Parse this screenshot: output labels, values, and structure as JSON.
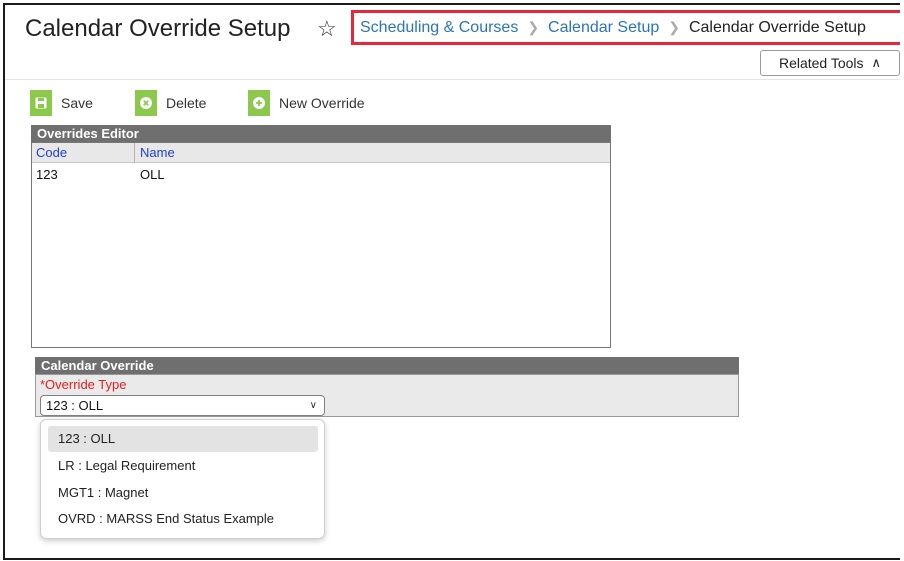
{
  "header": {
    "title": "Calendar Override Setup",
    "breadcrumb": [
      "Scheduling & Courses",
      "Calendar Setup",
      "Calendar Override Setup"
    ],
    "related_tools_label": "Related Tools"
  },
  "toolbar": {
    "save_label": "Save",
    "delete_label": "Delete",
    "new_override_label": "New Override"
  },
  "overrides_editor": {
    "title": "Overrides Editor",
    "columns": [
      "Code",
      "Name"
    ],
    "rows": [
      {
        "code": "123",
        "name": "OLL"
      }
    ]
  },
  "calendar_override": {
    "title": "Calendar Override",
    "field_label": "*Override Type",
    "selected_value": "123 : OLL",
    "options": [
      "123 : OLL",
      "LR : Legal Requirement",
      "MGT1 : Magnet",
      "OVRD : MARSS End Status Example"
    ]
  },
  "colors": {
    "accent_green": "#8cc84b",
    "breadcrumb_link": "#2a75b8",
    "highlight_border": "#e8283a",
    "required_label": "#e02020"
  }
}
